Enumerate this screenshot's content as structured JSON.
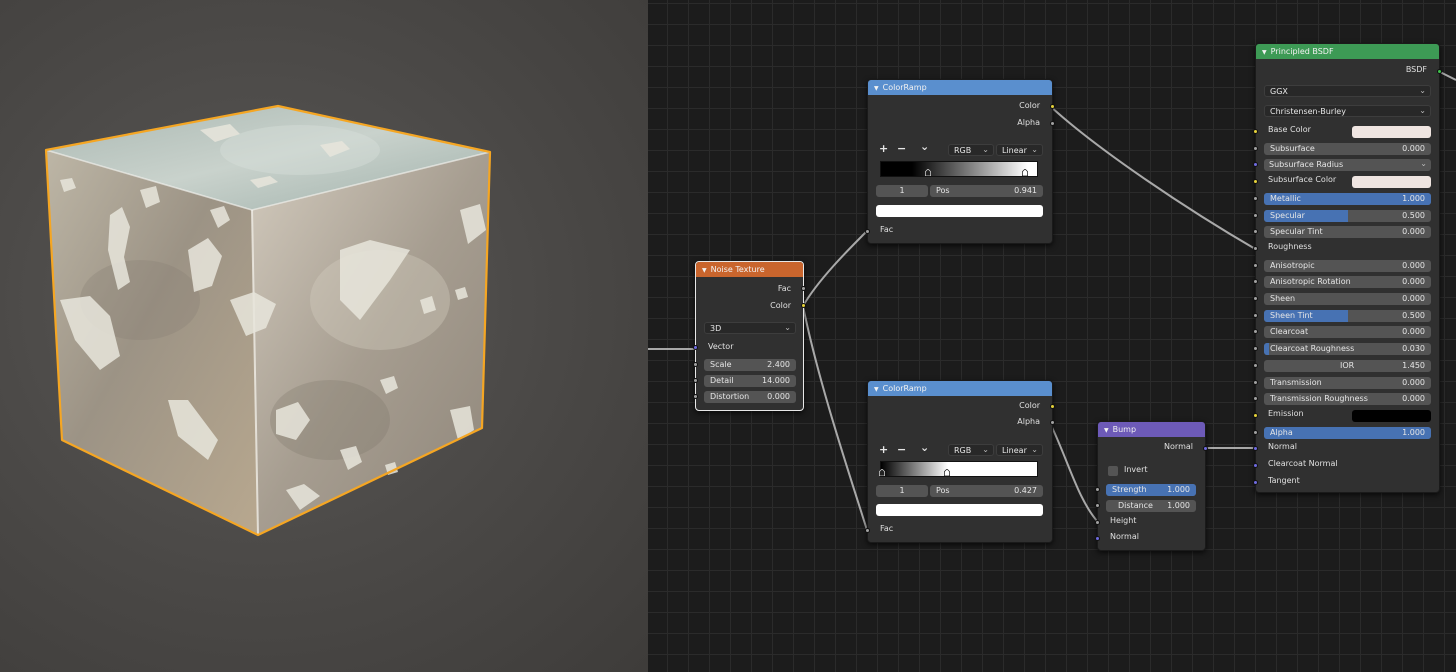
{
  "colors": {
    "node_bg": "#303030",
    "texture_header": "#c9652d",
    "converter_header": "#5a8fce",
    "vector_header": "#6d5ab8",
    "shader_header": "#3d9a55",
    "socket_color": "#e5d23a",
    "socket_float": "#a1a1a1",
    "socket_vector": "#6f6be0",
    "socket_shader": "#3fc24c",
    "slider_fill": "#4772b3",
    "selection_outline": "#f5a623"
  },
  "noise_texture": {
    "title": "Noise Texture",
    "outputs": [
      "Fac",
      "Color"
    ],
    "dimensions": "3D",
    "vector_label": "Vector",
    "fields": [
      {
        "label": "Scale",
        "value": "2.400"
      },
      {
        "label": "Detail",
        "value": "14.000"
      },
      {
        "label": "Distortion",
        "value": "0.000"
      }
    ]
  },
  "colorramp_top": {
    "title": "ColorRamp",
    "outputs": [
      "Color",
      "Alpha"
    ],
    "add": "+",
    "remove": "−",
    "menu": "⌄",
    "color_mode": "RGB",
    "interpolation": "Linear",
    "index": "1",
    "pos_label": "Pos",
    "pos_value": "0.941",
    "input": "Fac",
    "stops": [
      0.3,
      0.941
    ]
  },
  "colorramp_bottom": {
    "title": "ColorRamp",
    "outputs": [
      "Color",
      "Alpha"
    ],
    "add": "+",
    "remove": "−",
    "menu": "⌄",
    "color_mode": "RGB",
    "interpolation": "Linear",
    "index": "1",
    "pos_label": "Pos",
    "pos_value": "0.427",
    "input": "Fac",
    "stops": [
      0.0,
      0.427
    ]
  },
  "bump": {
    "title": "Bump",
    "output": "Normal",
    "invert_label": "Invert",
    "strength_label": "Strength",
    "strength_value": "1.000",
    "distance_label": "Distance",
    "distance_value": "1.000",
    "height_label": "Height",
    "normal_label": "Normal"
  },
  "principled": {
    "title": "Principled BSDF",
    "output": "BSDF",
    "distribution": "GGX",
    "subsurface_method": "Christensen-Burley",
    "rows": [
      {
        "label": "Base Color",
        "kind": "color",
        "value": ""
      },
      {
        "label": "Subsurface",
        "kind": "field",
        "value": "0.000",
        "fill": 0
      },
      {
        "label": "Subsurface Radius",
        "kind": "drop",
        "value": ""
      },
      {
        "label": "Subsurface Color",
        "kind": "color",
        "value": ""
      },
      {
        "label": "Metallic",
        "kind": "field",
        "value": "1.000",
        "fill": 1
      },
      {
        "label": "Specular",
        "kind": "field",
        "value": "0.500",
        "fill": 0.5
      },
      {
        "label": "Specular Tint",
        "kind": "field",
        "value": "0.000",
        "fill": 0
      },
      {
        "label": "Roughness",
        "kind": "socket",
        "value": ""
      },
      {
        "label": "Anisotropic",
        "kind": "field",
        "value": "0.000",
        "fill": 0
      },
      {
        "label": "Anisotropic Rotation",
        "kind": "field",
        "value": "0.000",
        "fill": 0
      },
      {
        "label": "Sheen",
        "kind": "field",
        "value": "0.000",
        "fill": 0
      },
      {
        "label": "Sheen Tint",
        "kind": "field",
        "value": "0.500",
        "fill": 0.5
      },
      {
        "label": "Clearcoat",
        "kind": "field",
        "value": "0.000",
        "fill": 0
      },
      {
        "label": "Clearcoat Roughness",
        "kind": "field",
        "value": "0.030",
        "fill": 0.03
      },
      {
        "label": "IOR",
        "kind": "center",
        "value": "1.450",
        "fill": 0
      },
      {
        "label": "Transmission",
        "kind": "field",
        "value": "0.000",
        "fill": 0
      },
      {
        "label": "Transmission Roughness",
        "kind": "field",
        "value": "0.000",
        "fill": 0
      },
      {
        "label": "Emission",
        "kind": "black",
        "value": ""
      },
      {
        "label": "Alpha",
        "kind": "field",
        "value": "1.000",
        "fill": 1
      },
      {
        "label": "Normal",
        "kind": "socket",
        "value": ""
      },
      {
        "label": "Clearcoat Normal",
        "kind": "socket",
        "value": ""
      },
      {
        "label": "Tangent",
        "kind": "socket",
        "value": ""
      }
    ]
  }
}
